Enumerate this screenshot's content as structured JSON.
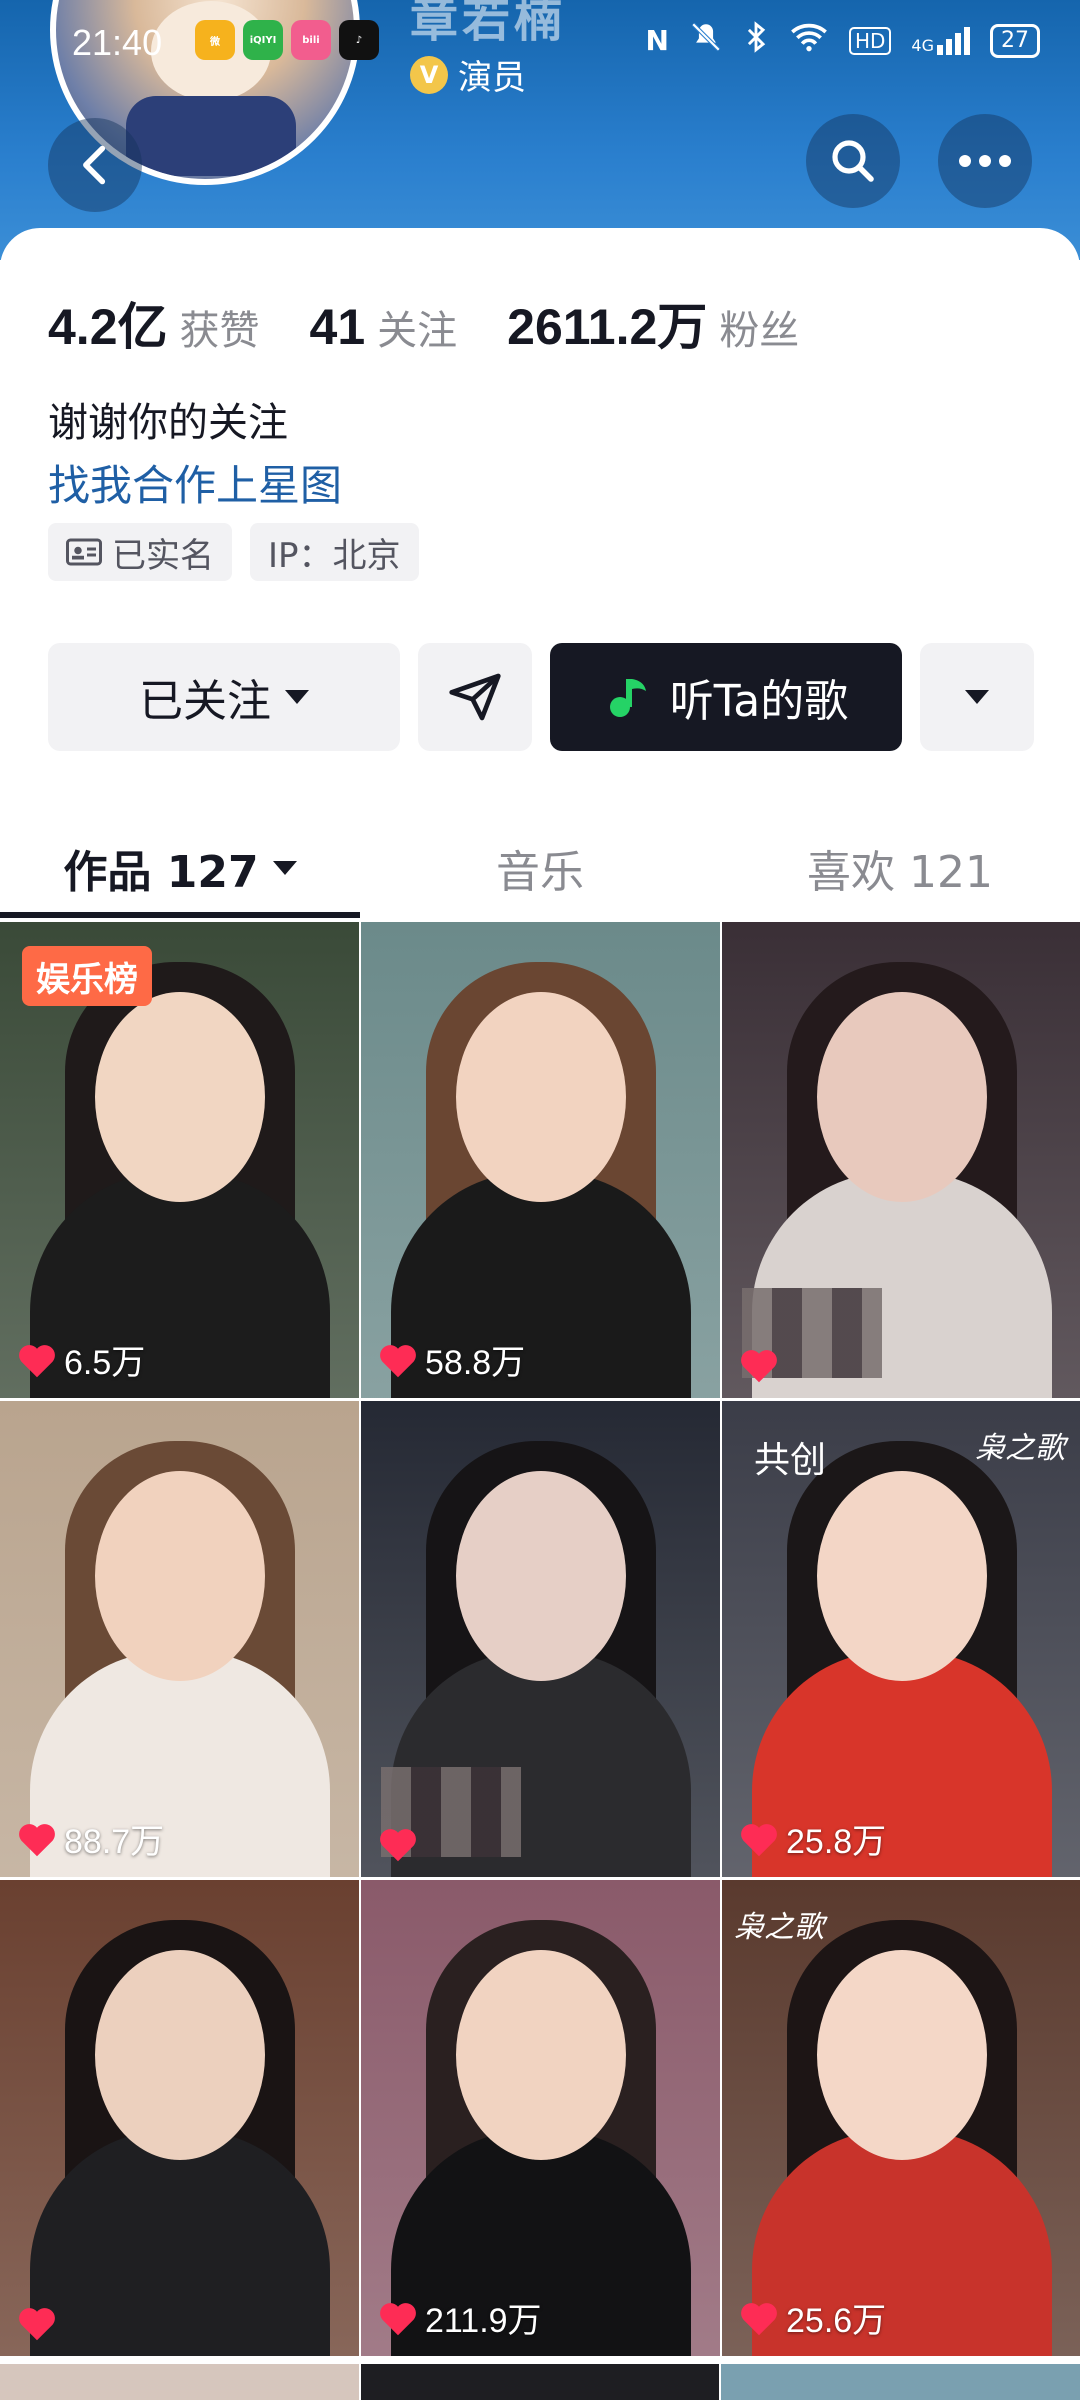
{
  "status_bar": {
    "time": "21:40",
    "battery": "27",
    "network": "4G",
    "hd": "HD",
    "nfc": "N"
  },
  "app_icons": [
    {
      "name": "weibo-icon",
      "color": "#f6b21d",
      "label": "微"
    },
    {
      "name": "iqiyi-icon",
      "color": "#2fb24a",
      "label": "iQIYI"
    },
    {
      "name": "bilibili-icon",
      "color": "#f25d8e",
      "label": "bili"
    },
    {
      "name": "douyin-icon",
      "color": "#111111",
      "label": "♪"
    }
  ],
  "profile": {
    "name": "章若楠",
    "role_badge": "演员",
    "verified_mark": "V"
  },
  "stats": [
    {
      "value": "4.2亿",
      "label": "获赞"
    },
    {
      "value": "41",
      "label": "关注"
    },
    {
      "value": "2611.2万",
      "label": "粉丝"
    }
  ],
  "bio": "谢谢你的关注",
  "link_text": "找我合作上星图",
  "tags": [
    {
      "label": "已实名",
      "icon": "id-card-icon"
    },
    {
      "label": "IP：北京",
      "icon": ""
    }
  ],
  "actions": {
    "follow_label": "已关注",
    "song_label": "听Ta的歌"
  },
  "tabs": [
    {
      "label": "作品 127",
      "active": true
    },
    {
      "label": "音乐",
      "active": false
    },
    {
      "label": "喜欢 121",
      "active": false
    }
  ],
  "tiles": [
    {
      "likes": "6.5万",
      "badge": "娱乐榜",
      "tag": "",
      "logo": "",
      "bg": "#3a4a38",
      "skin": "#f1d6c2",
      "hair": "#1f1a1a",
      "cloth": "#1c1c1c"
    },
    {
      "likes": "58.8万",
      "badge": "",
      "tag": "",
      "logo": "",
      "bg": "#6b8a8a",
      "skin": "#f2d3c0",
      "hair": "#6a4632",
      "cloth": "#1a1a1a"
    },
    {
      "likes": "",
      "badge": "",
      "tag": "",
      "logo": "",
      "bg": "#3a2f36",
      "skin": "#e8c9bd",
      "hair": "#241a1c",
      "cloth": "#d9d2cf",
      "mosaic": true
    },
    {
      "likes": "88.7万",
      "badge": "",
      "tag": "",
      "logo": "",
      "bg": "#b9a48e",
      "skin": "#f1d2be",
      "hair": "#6a4a36",
      "cloth": "#efe8e2"
    },
    {
      "likes": "",
      "badge": "",
      "tag": "",
      "logo": "",
      "bg": "#252934",
      "skin": "#e6cfc6",
      "hair": "#161416",
      "cloth": "#2b2b2e",
      "mosaic": true
    },
    {
      "likes": "25.8万",
      "badge": "",
      "tag": "共创",
      "logo": "枭之歌",
      "bg": "#3b3d48",
      "skin": "#f3d6c6",
      "hair": "#1b1718",
      "cloth": "#d8352a"
    },
    {
      "likes": "",
      "badge": "",
      "tag": "",
      "logo": "",
      "bg": "#6a4030",
      "skin": "#ecd0be",
      "hair": "#1a1414",
      "cloth": "#1f1f22"
    },
    {
      "likes": "211.9万",
      "badge": "",
      "tag": "",
      "logo": "",
      "bg": "#8a5a6a",
      "skin": "#f1d3c1",
      "hair": "#2a2020",
      "cloth": "#121214"
    },
    {
      "likes": "25.6万",
      "badge": "",
      "tag": "",
      "logo": "枭之歌",
      "logo_left": true,
      "bg": "#5a3a2e",
      "skin": "#f4d7c7",
      "hair": "#1d1515",
      "cloth": "#c8332b"
    }
  ]
}
